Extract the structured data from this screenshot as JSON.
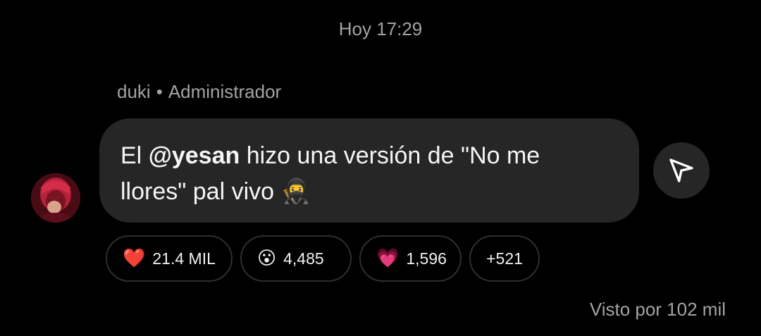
{
  "timestamp": "Hoy 17:29",
  "sender": {
    "name": "duki",
    "separator": "•",
    "role": "Administrador"
  },
  "message": {
    "prefix": "El ",
    "mention": "@yesan",
    "text_line1_rest": " hizo una versión de \"No me",
    "text_line2": "llores\" pal vivo ",
    "emoji": "🥷"
  },
  "reactions": [
    {
      "emoji": "❤️",
      "count": "21.4 MIL"
    },
    {
      "emoji": "😮",
      "count": "4,485"
    },
    {
      "emoji": "💗",
      "count": "1,596"
    }
  ],
  "reactions_more": "+521",
  "seen_by": "Visto por 102 mil",
  "icons": {
    "share": "paper-plane-icon",
    "avatar": "user-avatar"
  }
}
